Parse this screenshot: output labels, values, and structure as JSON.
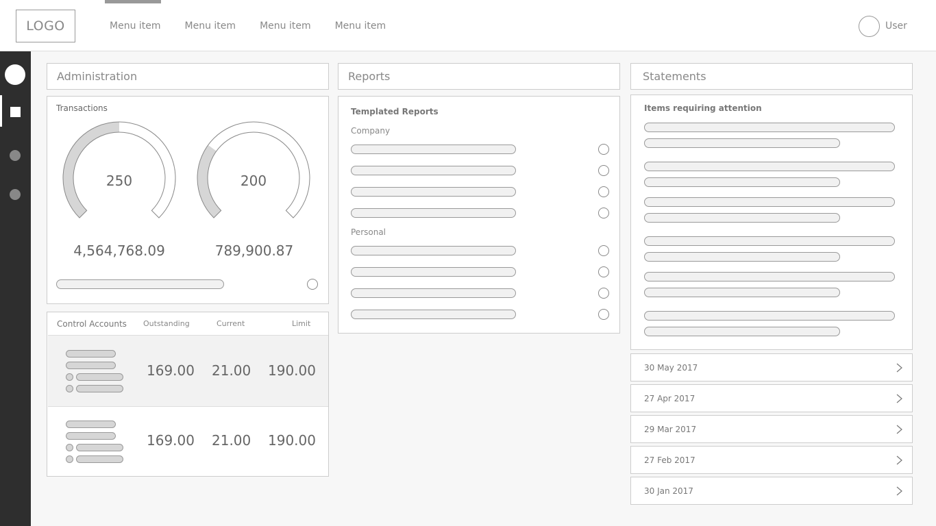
{
  "header": {
    "logo": "LOGO",
    "menu": [
      "Menu item",
      "Menu item",
      "Menu item",
      "Menu item"
    ],
    "user": "User"
  },
  "panels": {
    "administration": "Administration",
    "reports": "Reports",
    "statements": "Statements"
  },
  "transactions": {
    "title": "Transactions",
    "gauges": [
      {
        "value": "250",
        "amount": "4,564,768.09",
        "fill": 0.5
      },
      {
        "value": "200",
        "amount": "789,900.87",
        "fill": 0.3
      }
    ]
  },
  "control_accounts": {
    "headers": [
      "Control Accounts",
      "Outstanding",
      "Current",
      "Limit"
    ],
    "rows": [
      {
        "outstanding": "169.00",
        "current": "21.00",
        "limit": "190.00"
      },
      {
        "outstanding": "169.00",
        "current": "21.00",
        "limit": "190.00"
      }
    ]
  },
  "templated_reports": {
    "title": "Templated Reports",
    "company_label": "Company",
    "personal_label": "Personal"
  },
  "attention": {
    "title": "Items requiring attention"
  },
  "statements": {
    "dates": [
      "30 May 2017",
      "27 Apr 2017",
      "29 Mar 2017",
      "27 Feb 2017",
      "30 Jan 2017"
    ]
  },
  "colors": {
    "sidebar": "#2e2e2e",
    "accent_gray": "#999999",
    "gauge_fill": "#d6d6d6"
  }
}
